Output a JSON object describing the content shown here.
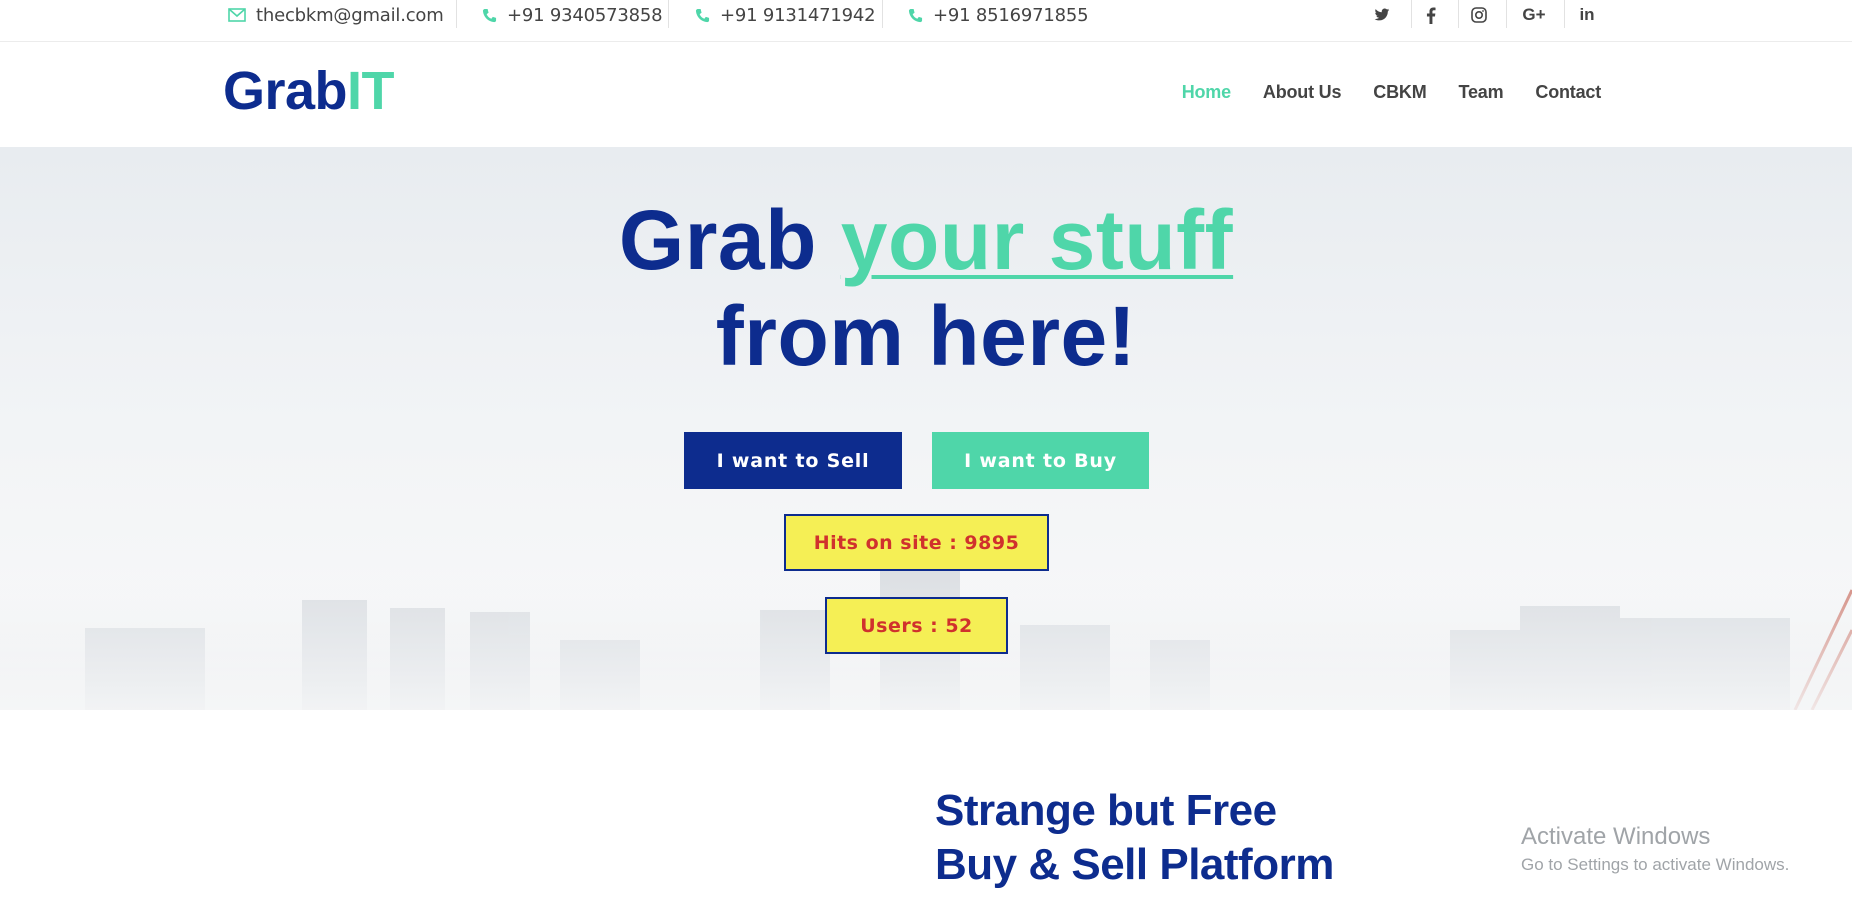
{
  "topbar": {
    "email": "thecbkm@gmail.com",
    "phones": [
      "+91 9340573858",
      "+91 9131471942",
      "+91 8516971855"
    ],
    "social": {
      "twitter": "twitter-icon",
      "facebook": "facebook-icon",
      "instagram": "instagram-icon",
      "googleplus_label": "G+",
      "linkedin_label": "in"
    }
  },
  "header": {
    "logo_part1": "Grab",
    "logo_part2": "IT",
    "nav": [
      "Home",
      "About Us",
      "CBKM",
      "Team",
      "Contact"
    ],
    "active": "Home"
  },
  "hero": {
    "title_part1": "Grab ",
    "title_accent": "your stuff",
    "title_line2": "from here!",
    "sell_button": "I want to Sell",
    "buy_button": "I want to Buy",
    "hits": "Hits on site : 9895",
    "users": "Users : 52"
  },
  "section": {
    "title_line1": "Strange but Free",
    "title_line2": "Buy & Sell Platform"
  },
  "watermark": {
    "line1": "Activate Windows",
    "line2": "Go to Settings to activate Windows."
  },
  "colors": {
    "brand_navy": "#0d2c8e",
    "brand_green": "#4fd6a9",
    "counter_yellow": "#f5ef55",
    "counter_text": "#d0312d"
  }
}
